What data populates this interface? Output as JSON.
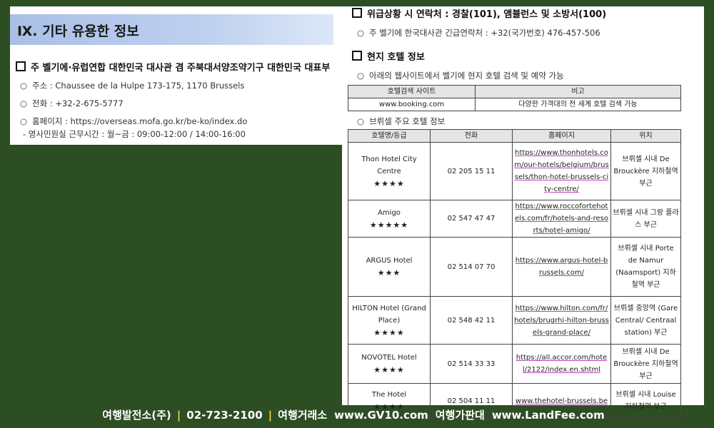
{
  "left": {
    "section_title": "Ⅸ. 기타 유용한 정보",
    "embassy_heading": "주 벨기에·유럽연합 대한민국 대사관 겸 주북대서양조약기구 대한민국 대표부",
    "address": "주소 : Chaussee de la Hulpe 173-175, 1170 Brussels",
    "phone": "전화 : +32-2-675-5777",
    "homepage": "홈페이지 : https://overseas.mofa.go.kr/be-ko/index.do",
    "consular_hours": "- 영사민원실 근무시간 : 월~금 : 09:00-12:00 / 14:00-16:00"
  },
  "right": {
    "emergency_heading": "위급상황 시 연락처 : 경찰(101), 앰뷸런스 및 소방서(100)",
    "emergency_contact": "주 벨기에 한국대사관 긴급연락처 : +32(국가번호) 476-457-506",
    "hotel_heading": "현지 호텔 정보",
    "hotel_search_note": "아래의 웹사이트에서 벨기에 현지 호텔 검색 및 예약 가능",
    "search_table": {
      "headers": [
        "호텔검색 사이트",
        "비고"
      ],
      "row": [
        "www.booking.com",
        "다양한 가격대의 전 세계 호텔 검색 가능"
      ]
    },
    "hotel_info_note": "브뤼셀 주요 호텔 정보",
    "hotel_table": {
      "headers": [
        "호텔명/등급",
        "전화",
        "홈페이지",
        "위치"
      ],
      "rows": [
        {
          "name": "Thon Hotel City Centre",
          "stars": "★★★★",
          "phone": "02 205 15 11",
          "url": "https://www.thonhotels.com/our-hotels/belgium/brussels/thon-hotel-brussels-city-centre/",
          "location": "브뤼셀 시내 De Brouckère 지하철역 부근"
        },
        {
          "name": "Amigo",
          "stars": "★★★★★",
          "phone": "02 547 47 47",
          "url": "https://www.roccofortehotels.com/fr/hotels-and-resorts/hotel-amigo/",
          "location": "브뤼셀 시내 그랑 플라스 부근"
        },
        {
          "name": "ARGUS Hotel",
          "stars": "★★★",
          "phone": "02 514 07 70",
          "url": "https://www.argus-hotel-brussels.com/",
          "location": "브뤼셀 시내 Porte de Namur (Naamsport) 지하철역 부근"
        },
        {
          "name": "HILTON Hotel (Grand Place)",
          "stars": "★★★★",
          "phone": "02 548 42 11",
          "url": "https://www.hilton.com/fr/hotels/brugrhi-hilton-brussels-grand-place/",
          "location": "브뤼셀 중앙역 (Gare Central/ Centraal station) 부근"
        },
        {
          "name": "NOVOTEL Hotel",
          "stars": "★★★★",
          "phone": "02 514 33 33",
          "url": "https://all.accor.com/hotel/2122/index.en.shtml",
          "location": "브뤼셀 시내 De Brouckère 지하철역 부근"
        },
        {
          "name": "The Hotel",
          "stars": "★★★★",
          "phone": "02 504 11 11",
          "url": "www.thehotel-brussels.be",
          "location": "브뤼셀 시내 Louise 지하철역 부근"
        }
      ]
    }
  },
  "footer": {
    "company": "여행발전소(주)",
    "phone": "02-723-2100",
    "exchange_label": "여행거래소",
    "exchange_url": "www.GV10.com",
    "price_label": "여행가판대",
    "price_url": "www.LandFee.com"
  },
  "colors": {
    "background": "#2d4d23",
    "banner": "#b4c8ec",
    "footer_separator": "#f3d04a"
  }
}
